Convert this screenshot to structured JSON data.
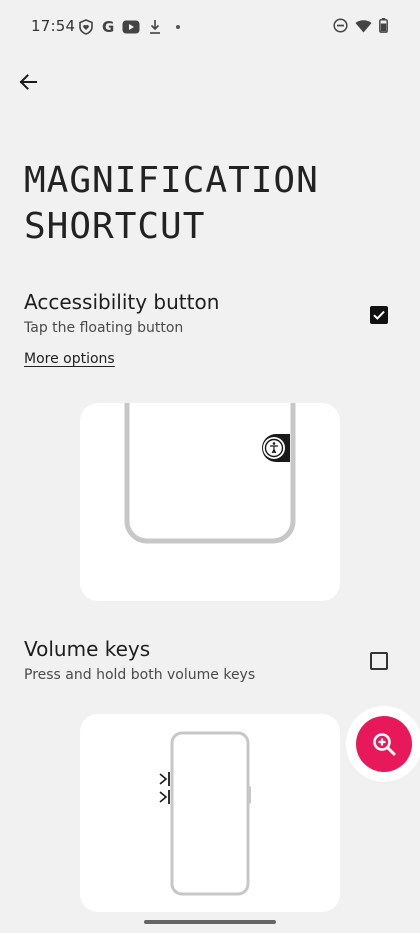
{
  "status_bar": {
    "time": "17:54",
    "left_icons": [
      "shield-heart-icon",
      "google-icon",
      "youtube-icon",
      "download-icon",
      "dot-icon"
    ],
    "right_icons": [
      "dnd-icon",
      "wifi-icon",
      "battery-icon"
    ]
  },
  "header": {
    "back_icon": "arrow-back-icon",
    "title_line1": "MAGNIFICATION",
    "title_line2": "SHORTCUT"
  },
  "accessibility_option": {
    "title": "Accessibility button",
    "subtitle": "Tap the floating button",
    "checked": true,
    "more_options_label": "More options"
  },
  "volume_option": {
    "title": "Volume keys",
    "subtitle": "Press and hold both volume keys",
    "checked": false
  },
  "fab": {
    "icon": "magnify-plus-icon"
  },
  "colors": {
    "background": "#f1f1f1",
    "card": "#ffffff",
    "accent": "#e8195b",
    "text": "#1b1b1b"
  }
}
